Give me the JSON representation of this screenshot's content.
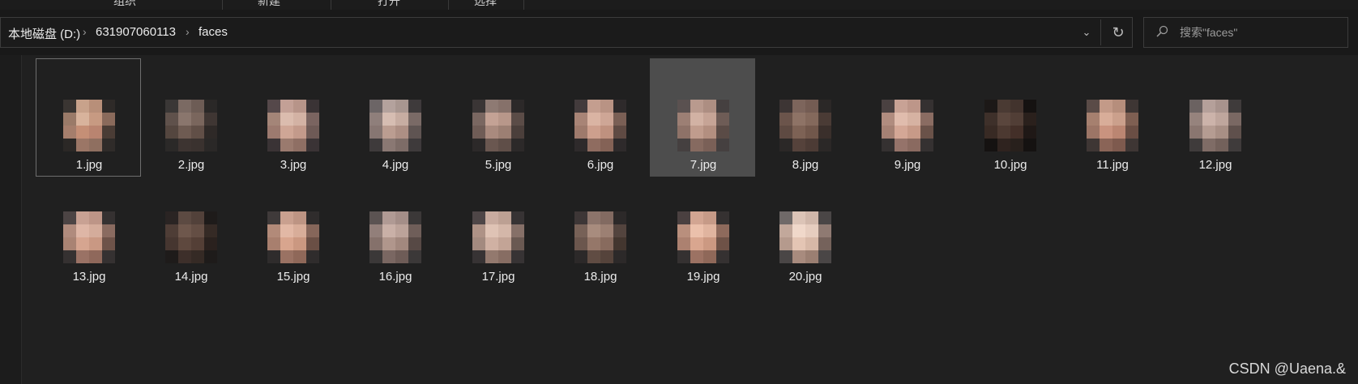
{
  "ribbon": {
    "labels": [
      "组织",
      "新建",
      "打开",
      "选择"
    ]
  },
  "address_bar": {
    "crumbs": [
      "本地磁盘 (D:)",
      "631907060113",
      "faces"
    ],
    "dropdown_glyph": "⌄",
    "refresh_glyph": "↻"
  },
  "search": {
    "placeholder": "搜索\"faces\"",
    "icon": "search-icon"
  },
  "files": [
    {
      "name": "1.jpg",
      "state": "selected",
      "colors": [
        "#3a3532",
        "#c8a28b",
        "#b88f79",
        "#2e2a28",
        "#9a7a68",
        "#d8b39c",
        "#c79a82",
        "#8a6a5b",
        "#a57e6c",
        "#c58f76",
        "#b98470",
        "#4a3c35",
        "#2b2826",
        "#9b7666",
        "#8f6f60",
        "#2f2b29"
      ]
    },
    {
      "name": "2.jpg",
      "state": "normal",
      "colors": [
        "#3a3736",
        "#7b6a63",
        "#6d5c55",
        "#2a2827",
        "#5f514b",
        "#8a766d",
        "#7a665d",
        "#3f3633",
        "#54463f",
        "#6e5b52",
        "#614f47",
        "#2e2927",
        "#2b2928",
        "#3d3431",
        "#3a322f",
        "#2a2827"
      ]
    },
    {
      "name": "3.jpg",
      "state": "normal",
      "colors": [
        "#55484a",
        "#c3a096",
        "#b79489",
        "#3a3335",
        "#a48578",
        "#dbbcae",
        "#d3b2a4",
        "#7a6460",
        "#9c7a6f",
        "#cfa696",
        "#c39a8b",
        "#6e5a56",
        "#3a3335",
        "#9a7a6e",
        "#8f6f64",
        "#3a3335"
      ]
    },
    {
      "name": "4.jpg",
      "state": "normal",
      "colors": [
        "#6c6566",
        "#b4a29d",
        "#a89690",
        "#3e3a3b",
        "#8f7f7b",
        "#d6bdb2",
        "#c7ada2",
        "#7a6a66",
        "#877672",
        "#bb9d91",
        "#ad8f84",
        "#5f5452",
        "#3e3a3b",
        "#8a7873",
        "#7d6c67",
        "#3e3a3b"
      ]
    },
    {
      "name": "5.jpg",
      "state": "normal",
      "colors": [
        "#3a3535",
        "#8e7a73",
        "#86716a",
        "#2c2929",
        "#7a6761",
        "#c4a295",
        "#b8978a",
        "#5b4c47",
        "#6f5c56",
        "#a98a7e",
        "#9c7f73",
        "#4b3f3b",
        "#2c2929",
        "#6a5750",
        "#5f4e48",
        "#2c2929"
      ]
    },
    {
      "name": "6.jpg",
      "state": "normal",
      "colors": [
        "#433b3c",
        "#c49e8f",
        "#b99384",
        "#2e2a2b",
        "#a88476",
        "#dab4a3",
        "#cea696",
        "#7a5f55",
        "#9e7a6c",
        "#cd9f8d",
        "#bf917f",
        "#5f4a43",
        "#2e2a2b",
        "#8f6c60",
        "#846256",
        "#2e2a2b"
      ]
    },
    {
      "name": "7.jpg",
      "state": "hover",
      "colors": [
        "#5a5150",
        "#b99a8e",
        "#ad8e82",
        "#454040",
        "#9c7f74",
        "#d2b2a4",
        "#c6a496",
        "#6e5c56",
        "#8e7268",
        "#c09c8d",
        "#b38f80",
        "#5a4b46",
        "#454040",
        "#866a60",
        "#7a6057",
        "#454040"
      ]
    },
    {
      "name": "8.jpg",
      "state": "normal",
      "colors": [
        "#3d3534",
        "#7d655c",
        "#745c53",
        "#2b2827",
        "#6b544b",
        "#8e7366",
        "#84695c",
        "#4a3b35",
        "#5e4a42",
        "#7d6255",
        "#71574b",
        "#3a2f2b",
        "#2b2827",
        "#55423b",
        "#4c3b35",
        "#2b2827"
      ]
    },
    {
      "name": "9.jpg",
      "state": "normal",
      "colors": [
        "#4a4141",
        "#c8a295",
        "#bd9689",
        "#353131",
        "#b08c7f",
        "#e0bcad",
        "#d6b2a2",
        "#8a6c62",
        "#a58174",
        "#d4a796",
        "#c79a88",
        "#6a5249",
        "#353131",
        "#95736a",
        "#8a6a60",
        "#353131"
      ]
    },
    {
      "name": "10.jpg",
      "state": "normal",
      "colors": [
        "#1c1817",
        "#4a3a33",
        "#42332d",
        "#151211",
        "#3e302a",
        "#5a463d",
        "#513e36",
        "#2a201c",
        "#382a24",
        "#4c3931",
        "#432f28",
        "#1f1816",
        "#151211",
        "#2f231f",
        "#28201c",
        "#151211"
      ]
    },
    {
      "name": "11.jpg",
      "state": "normal",
      "colors": [
        "#5a4b47",
        "#c39a88",
        "#b68e7c",
        "#3e3634",
        "#a6806f",
        "#d8ad99",
        "#cba08c",
        "#7e5f52",
        "#9c7566",
        "#c9937f",
        "#bb8672",
        "#6a4e44",
        "#3e3634",
        "#8a6457",
        "#7e5a4e",
        "#3e3634"
      ]
    },
    {
      "name": "12.jpg",
      "state": "normal",
      "colors": [
        "#6b6261",
        "#b5a09a",
        "#a8938d",
        "#3f3b3b",
        "#96837d",
        "#ccb3aa",
        "#bfa69d",
        "#7a6863",
        "#8a7670",
        "#b59c92",
        "#a88f85",
        "#5f504c",
        "#3f3b3b",
        "#7f6c66",
        "#73615b",
        "#3f3b3b"
      ]
    },
    {
      "name": "13.jpg",
      "state": "normal",
      "colors": [
        "#4c4444",
        "#c8a193",
        "#bd9587",
        "#353131",
        "#b08b7d",
        "#deb6a6",
        "#d4ac9b",
        "#8a6b60",
        "#a98373",
        "#d6a590",
        "#c99883",
        "#6e5349",
        "#353131",
        "#9a7265",
        "#8f685b",
        "#353131"
      ]
    },
    {
      "name": "14.jpg",
      "state": "normal",
      "colors": [
        "#2a2423",
        "#5c4a42",
        "#52413a",
        "#1e1b1a",
        "#4e3d36",
        "#6e574c",
        "#644e44",
        "#352a25",
        "#463630",
        "#5e483e",
        "#543f36",
        "#2a211e",
        "#1e1b1a",
        "#3d2f2a",
        "#352a25",
        "#1e1b1a"
      ]
    },
    {
      "name": "15.jpg",
      "state": "normal",
      "colors": [
        "#3f3a3a",
        "#c9a08f",
        "#bd9483",
        "#2f2c2c",
        "#b28a79",
        "#e2b8a5",
        "#d8ad99",
        "#86665a",
        "#a87f6e",
        "#d8a58e",
        "#cb9881",
        "#6a4f45",
        "#2f2c2c",
        "#9a7263",
        "#8f6859",
        "#2f2c2c"
      ]
    },
    {
      "name": "16.jpg",
      "state": "normal",
      "colors": [
        "#5b5352",
        "#b09a94",
        "#a48e88",
        "#3b3838",
        "#927f7a",
        "#c9b0a7",
        "#bca39a",
        "#6f5e59",
        "#85716b",
        "#b0968c",
        "#a2887e",
        "#574945",
        "#3b3838",
        "#7a6762",
        "#6e5c57",
        "#3b3838"
      ]
    },
    {
      "name": "17.jpg",
      "state": "normal",
      "colors": [
        "#4e4647",
        "#c8ab9f",
        "#bca093",
        "#373334",
        "#ae9286",
        "#dfc3b5",
        "#d4b7a9",
        "#867068",
        "#a38a7f",
        "#d0b1a3",
        "#c3a496",
        "#6a5952",
        "#373334",
        "#93796e",
        "#876d63",
        "#373334"
      ]
    },
    {
      "name": "18.jpg",
      "state": "normal",
      "colors": [
        "#3d3636",
        "#8c746b",
        "#826a61",
        "#2c2929",
        "#776157",
        "#a88c7e",
        "#9c8073",
        "#53443e",
        "#6b564d",
        "#957769",
        "#886b5e",
        "#43362f",
        "#2c2929",
        "#604c43",
        "#55433b",
        "#2c2929"
      ]
    },
    {
      "name": "19.jpg",
      "state": "normal",
      "colors": [
        "#4a4040",
        "#d2a592",
        "#c69a87",
        "#353131",
        "#b98f7d",
        "#ebc0ab",
        "#e0b49f",
        "#8e6a5c",
        "#ac8170",
        "#d9a68f",
        "#cc9982",
        "#6e5247",
        "#353131",
        "#9c7263",
        "#8f6859",
        "#353131"
      ]
    },
    {
      "name": "20.jpg",
      "state": "normal",
      "colors": [
        "#6f6968",
        "#dcc4b7",
        "#d0b7aa",
        "#4a4646",
        "#c2a89b",
        "#f0d8ca",
        "#e6cdbf",
        "#8f7a72",
        "#b59a8d",
        "#e4c5b4",
        "#d7b8a7",
        "#75625b",
        "#4a4646",
        "#a88b7e",
        "#9b7f72",
        "#4a4646"
      ]
    }
  ],
  "watermark": "CSDN @Uaena.&"
}
